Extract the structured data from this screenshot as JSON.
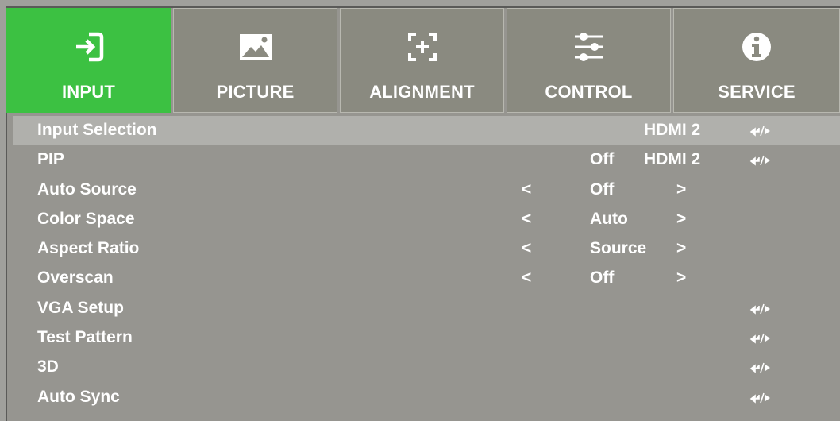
{
  "tabs": [
    {
      "label": "INPUT",
      "icon": "input-icon",
      "active": true
    },
    {
      "label": "PICTURE",
      "icon": "picture-icon",
      "active": false
    },
    {
      "label": "ALIGNMENT",
      "icon": "alignment-icon",
      "active": false
    },
    {
      "label": "CONTROL",
      "icon": "sliders-icon",
      "active": false
    },
    {
      "label": "SERVICE",
      "icon": "info-icon",
      "active": false
    }
  ],
  "rows": [
    {
      "label": "Input Selection",
      "value": "HDMI 2",
      "enter": true,
      "selected": true
    },
    {
      "label": "PIP",
      "value": "Off",
      "value2": "HDMI 2",
      "enter": true
    },
    {
      "label": "Auto Source",
      "left": "<",
      "value": "Off",
      "right": ">"
    },
    {
      "label": "Color Space",
      "left": "<",
      "value": "Auto",
      "right": ">"
    },
    {
      "label": "Aspect Ratio",
      "left": "<",
      "value": "Source",
      "right": ">"
    },
    {
      "label": "Overscan",
      "left": "<",
      "value": "Off",
      "right": ">"
    },
    {
      "label": "VGA Setup",
      "enter": true
    },
    {
      "label": "Test Pattern",
      "enter": true
    },
    {
      "label": "3D",
      "enter": true
    },
    {
      "label": "Auto Sync",
      "enter": true
    }
  ],
  "colors": {
    "active_tab": "#3cc142",
    "tab_bg": "#8a8a80",
    "panel_bg": "#969590",
    "selected_row": "#b0b0ac"
  }
}
